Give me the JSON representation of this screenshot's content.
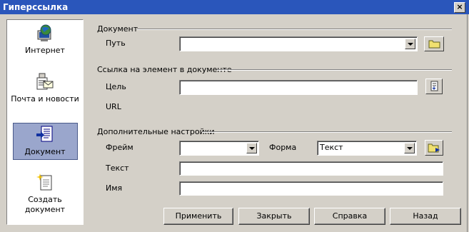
{
  "window": {
    "title": "Гиперссылка",
    "close_glyph": "×"
  },
  "sidebar": {
    "items": [
      {
        "label": "Интернет",
        "icon": "globe-computer-icon"
      },
      {
        "label": "Почта и новости",
        "icon": "mail-news-icon"
      },
      {
        "label": "Документ",
        "icon": "document-icon",
        "selected": true
      },
      {
        "label": "Создать документ",
        "icon": "new-document-icon"
      }
    ]
  },
  "sections": {
    "document": {
      "title": "Документ",
      "path_label": "Путь",
      "path_value": ""
    },
    "target": {
      "title": "Ссылка на элемент в документе",
      "target_label": "Цель",
      "target_value": "",
      "url_label": "URL"
    },
    "extra": {
      "title": "Дополнительные настройки",
      "frame_label": "Фрейм",
      "frame_value": "",
      "form_label": "Форма",
      "form_value": "Текст",
      "text_label": "Текст",
      "text_value": "",
      "name_label": "Имя",
      "name_value": ""
    }
  },
  "buttons": {
    "apply": "Применить",
    "close": "Закрыть",
    "help": "Справка",
    "back": "Назад"
  }
}
